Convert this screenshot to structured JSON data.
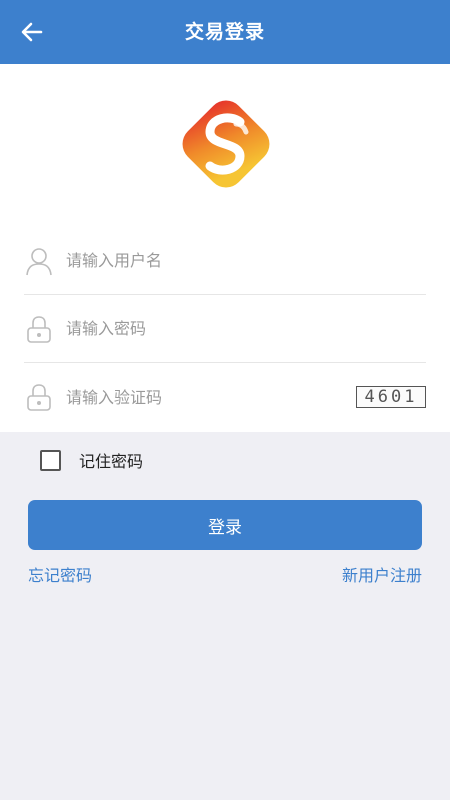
{
  "header": {
    "title": "交易登录",
    "back_icon": "arrow-left-icon"
  },
  "logo": {
    "icon": "brand-logo-icon",
    "colors": [
      "#e52b2b",
      "#f08a2a",
      "#f6c533"
    ]
  },
  "form": {
    "username": {
      "value": "",
      "placeholder": "请输入用户名",
      "icon": "user-icon"
    },
    "password": {
      "value": "",
      "placeholder": "请输入密码",
      "icon": "lock-icon"
    },
    "captcha": {
      "value": "",
      "placeholder": "请输入验证码",
      "icon": "lock-icon",
      "code": "4601"
    }
  },
  "remember": {
    "label": "记住密码",
    "checked": false
  },
  "login_button": {
    "label": "登录"
  },
  "links": {
    "forgot": "忘记密码",
    "register": "新用户注册"
  },
  "colors": {
    "primary": "#3d80cd",
    "background": "#efeff4"
  }
}
